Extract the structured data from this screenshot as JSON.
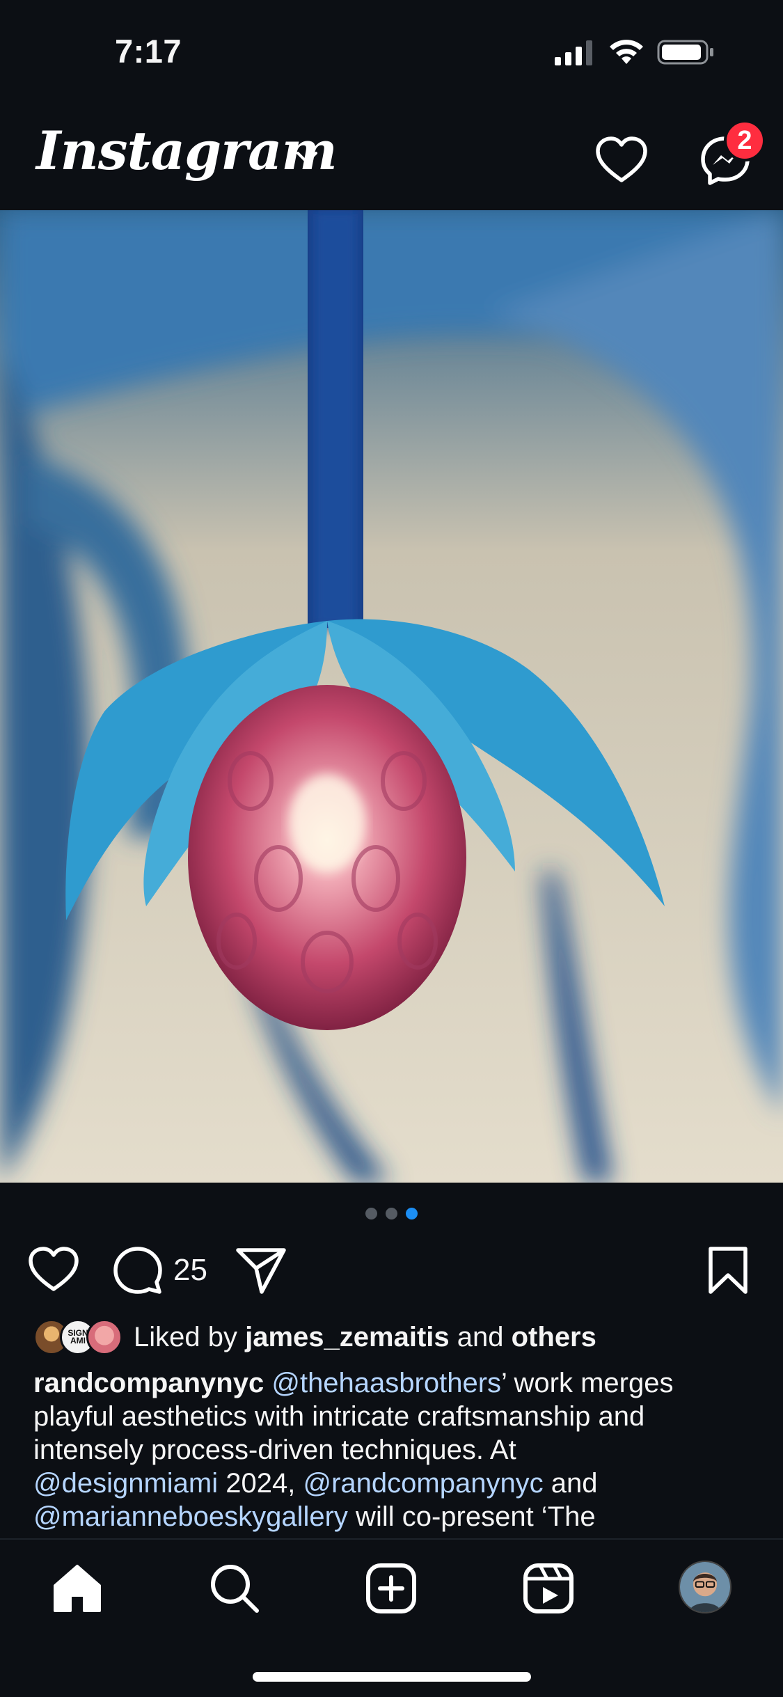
{
  "status_bar": {
    "time": "7:17"
  },
  "header": {
    "logo": "Instagram",
    "notification_badge": "2"
  },
  "post": {
    "carousel": {
      "total": 3,
      "active_index": 2
    },
    "comment_count": "25",
    "likes": {
      "prefix": "Liked by",
      "user": "james_zemaitis",
      "connector": "and",
      "suffix": "others"
    },
    "liker_avatar_text": "SIGN AMI",
    "caption": {
      "username": "randcompanynyc",
      "mention1": "@thehaasbrothers",
      "text1": "’ work merges playful aesthetics with intricate craftsmanship and intensely process-driven techniques. At",
      "mention2": "@designmiami",
      "text2": " 2024, ",
      "mention3": "@randcompanynyc",
      "text3": " and",
      "mention4": "@marianneboeskygallery",
      "text4": " will co-present ‘The"
    }
  },
  "colors": {
    "background": "#0c0f14",
    "accent": "#1c8ef3",
    "badge": "#ff2d3f",
    "mention": "#b5d5ff"
  }
}
